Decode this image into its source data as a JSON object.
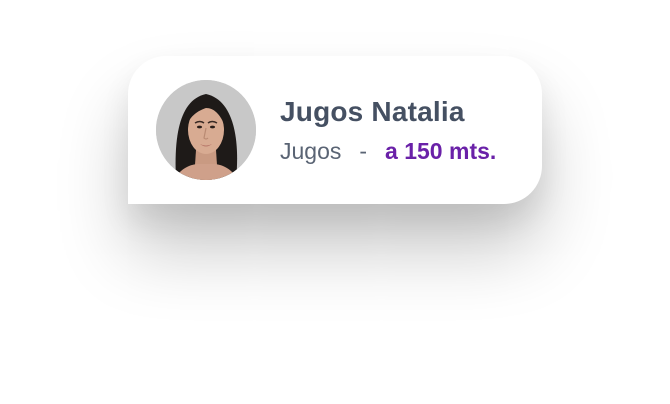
{
  "profile_card": {
    "name": "Jugos Natalia",
    "category": "Jugos",
    "separator": "-",
    "distance": "a 150 mts.",
    "colors": {
      "name": "#455062",
      "category": "#5a6474",
      "distance_accent": "#6a21a8",
      "card_background": "#ffffff"
    },
    "avatar_icon": "user-photo-avatar"
  }
}
